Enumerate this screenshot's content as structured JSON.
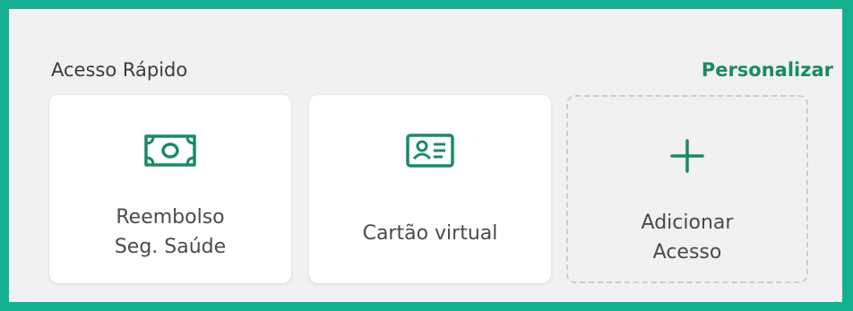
{
  "header": {
    "title": "Acesso Rápido",
    "action": "Personalizar"
  },
  "cards": [
    {
      "label": "Reembolso\nSeg. Saúde",
      "icon": "money-bill-icon"
    },
    {
      "label": "Cartão virtual",
      "icon": "id-card-icon"
    },
    {
      "label": "Adicionar\nAcesso",
      "icon": "plus-icon"
    }
  ],
  "colors": {
    "accent": "#1a8a63",
    "frame_border": "#12b08f",
    "background": "#f1f1f1",
    "text": "#4a4a4a"
  }
}
